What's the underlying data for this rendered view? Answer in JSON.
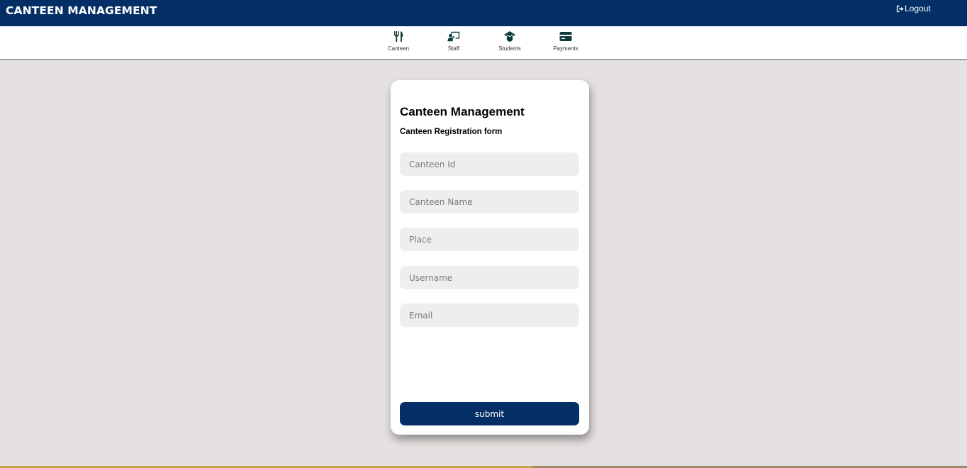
{
  "header": {
    "title": "CANTEEN MANAGEMENT",
    "logout_label": "Logout",
    "background": "#042f66"
  },
  "nav": {
    "items": [
      {
        "label": "Canteen",
        "icon": "utensils-icon"
      },
      {
        "label": "Staff",
        "icon": "chalkboard-teacher-icon"
      },
      {
        "label": "Students",
        "icon": "graduation-cap-icon"
      },
      {
        "label": "Payments",
        "icon": "credit-card-icon"
      }
    ],
    "icon_color": "#0d3b3b"
  },
  "form": {
    "title": "Canteen Management",
    "subtitle": "Canteen Registration form",
    "fields": [
      {
        "placeholder": "Canteen Id",
        "value": ""
      },
      {
        "placeholder": "Canteen Name",
        "value": ""
      },
      {
        "placeholder": "Place",
        "value": ""
      },
      {
        "placeholder": "Username",
        "value": ""
      },
      {
        "placeholder": "Email",
        "value": ""
      }
    ],
    "submit_label": "submit",
    "accent": "#042f66"
  }
}
